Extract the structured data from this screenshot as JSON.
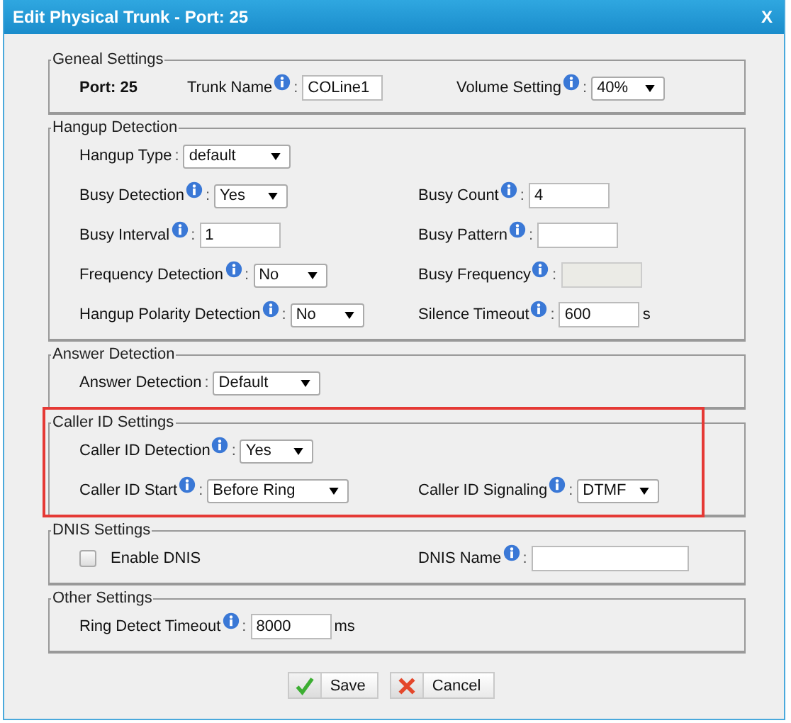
{
  "window": {
    "title": "Edit Physical Trunk - Port: 25",
    "close": "X"
  },
  "sections": [
    {
      "legend": "Geneal Settings",
      "highlighted": false,
      "rows": [
        [
          {
            "kind": "static",
            "label": "Port: 25"
          },
          {
            "kind": "text",
            "label": "Trunk Name",
            "info": true,
            "sep": ":",
            "value": "COLine1"
          },
          {
            "kind": "select",
            "label": "Volume Setting",
            "info": true,
            "sep": ":",
            "value": "40%"
          }
        ]
      ]
    },
    {
      "legend": "Hangup Detection",
      "highlighted": false,
      "rows": [
        [
          {
            "kind": "select",
            "label": "Hangup Type",
            "info": false,
            "sep": ":",
            "value": "default"
          }
        ],
        [
          {
            "kind": "select",
            "label": "Busy Detection",
            "info": true,
            "sep": ":",
            "value": "Yes"
          },
          {
            "kind": "text",
            "label": "Busy Count",
            "info": true,
            "sep": ":",
            "value": "4"
          }
        ],
        [
          {
            "kind": "text",
            "label": "Busy Interval",
            "info": true,
            "sep": ":",
            "value": "1"
          },
          {
            "kind": "text",
            "label": "Busy Pattern",
            "info": true,
            "sep": ":"
          }
        ],
        [
          {
            "kind": "select",
            "label": "Frequency Detection",
            "info": true,
            "sep": ":",
            "value": "No"
          },
          {
            "kind": "text",
            "label": "Busy Frequency",
            "info": true,
            "sep": ":",
            "disabled": true
          }
        ],
        [
          {
            "kind": "select",
            "label": "Hangup Polarity Detection",
            "info": true,
            "sep": ":",
            "value": "No"
          },
          {
            "kind": "text",
            "label": "Silence Timeout",
            "info": true,
            "sep": ":",
            "value": "600",
            "unit": "s"
          }
        ]
      ]
    },
    {
      "legend": "Answer Detection",
      "highlighted": false,
      "rows": [
        [
          {
            "kind": "select",
            "label": "Answer Detection",
            "info": false,
            "sep": ":",
            "value": "Default"
          }
        ]
      ]
    },
    {
      "legend": "Caller ID Settings",
      "highlighted": true,
      "rows": [
        [
          {
            "kind": "select",
            "label": "Caller ID Detection",
            "info": true,
            "sep": ":",
            "value": "Yes"
          }
        ],
        [
          {
            "kind": "select",
            "label": "Caller ID Start",
            "info": true,
            "sep": ":",
            "value": "Before Ring"
          },
          {
            "kind": "select",
            "label": "Caller ID Signaling",
            "info": true,
            "sep": ":",
            "value": "DTMF"
          }
        ]
      ]
    },
    {
      "legend": "DNIS Settings",
      "highlighted": false,
      "rows": [
        [
          {
            "kind": "checkbox",
            "label": "Enable DNIS",
            "checked": false
          },
          {
            "kind": "text",
            "label": "DNIS Name",
            "info": true,
            "sep": ":",
            "wide": true
          }
        ]
      ]
    },
    {
      "legend": "Other Settings",
      "highlighted": false,
      "rows": [
        [
          {
            "kind": "text",
            "label": "Ring Detect Timeout",
            "info": true,
            "sep": ":",
            "value": "8000",
            "unit": "ms"
          }
        ]
      ]
    }
  ],
  "buttons": [
    {
      "kind": "save",
      "label": "Save"
    },
    {
      "kind": "cancel",
      "label": "Cancel"
    }
  ]
}
